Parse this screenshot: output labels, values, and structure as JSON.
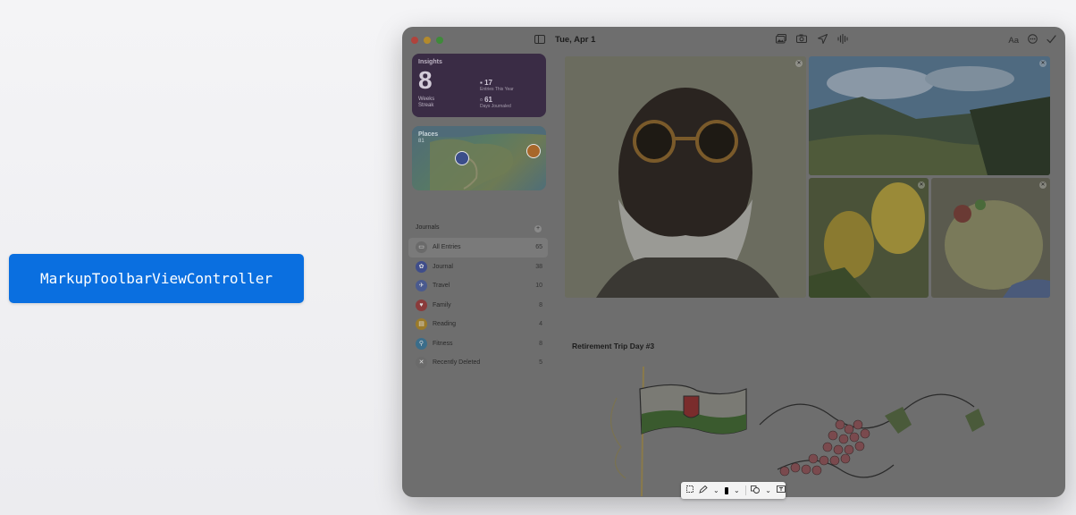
{
  "badge": {
    "text": "MarkupToolbarViewController"
  },
  "window": {
    "title": "Tue, Apr 1",
    "toolbar_right": {
      "format": "Aa"
    }
  },
  "insights": {
    "title": "Insights",
    "streak_value": "8",
    "streak_unit": "Weeks",
    "streak_label": "Streak",
    "entries_value": "17",
    "entries_label": "Entries This Year",
    "days_value": "61",
    "days_label": "Days Journaled"
  },
  "places": {
    "title": "Places",
    "count": "81"
  },
  "journals": {
    "header": "Journals",
    "items": [
      {
        "label": "All Entries",
        "count": "65",
        "icon": "tray-icon",
        "color": "#6a6a6a"
      },
      {
        "label": "Journal",
        "count": "38",
        "icon": "butterfly-icon",
        "color": "#3f4d8a"
      },
      {
        "label": "Travel",
        "count": "10",
        "icon": "airplane-icon",
        "color": "#4a5a8e"
      },
      {
        "label": "Family",
        "count": "8",
        "icon": "heart-icon",
        "color": "#8a3b3b"
      },
      {
        "label": "Reading",
        "count": "4",
        "icon": "book-icon",
        "color": "#9a7a2a"
      },
      {
        "label": "Fitness",
        "count": "8",
        "icon": "figure-icon",
        "color": "#3b6d8a"
      },
      {
        "label": "Recently Deleted",
        "count": "5",
        "icon": "trash-icon",
        "color": "#6a6a6a"
      }
    ]
  },
  "entry": {
    "title": "Retirement Trip Day #3"
  },
  "colors": {
    "badge": "#0a6fe0",
    "insights_bg": "#3a2c45",
    "window_dim": "#6e6e6e"
  }
}
